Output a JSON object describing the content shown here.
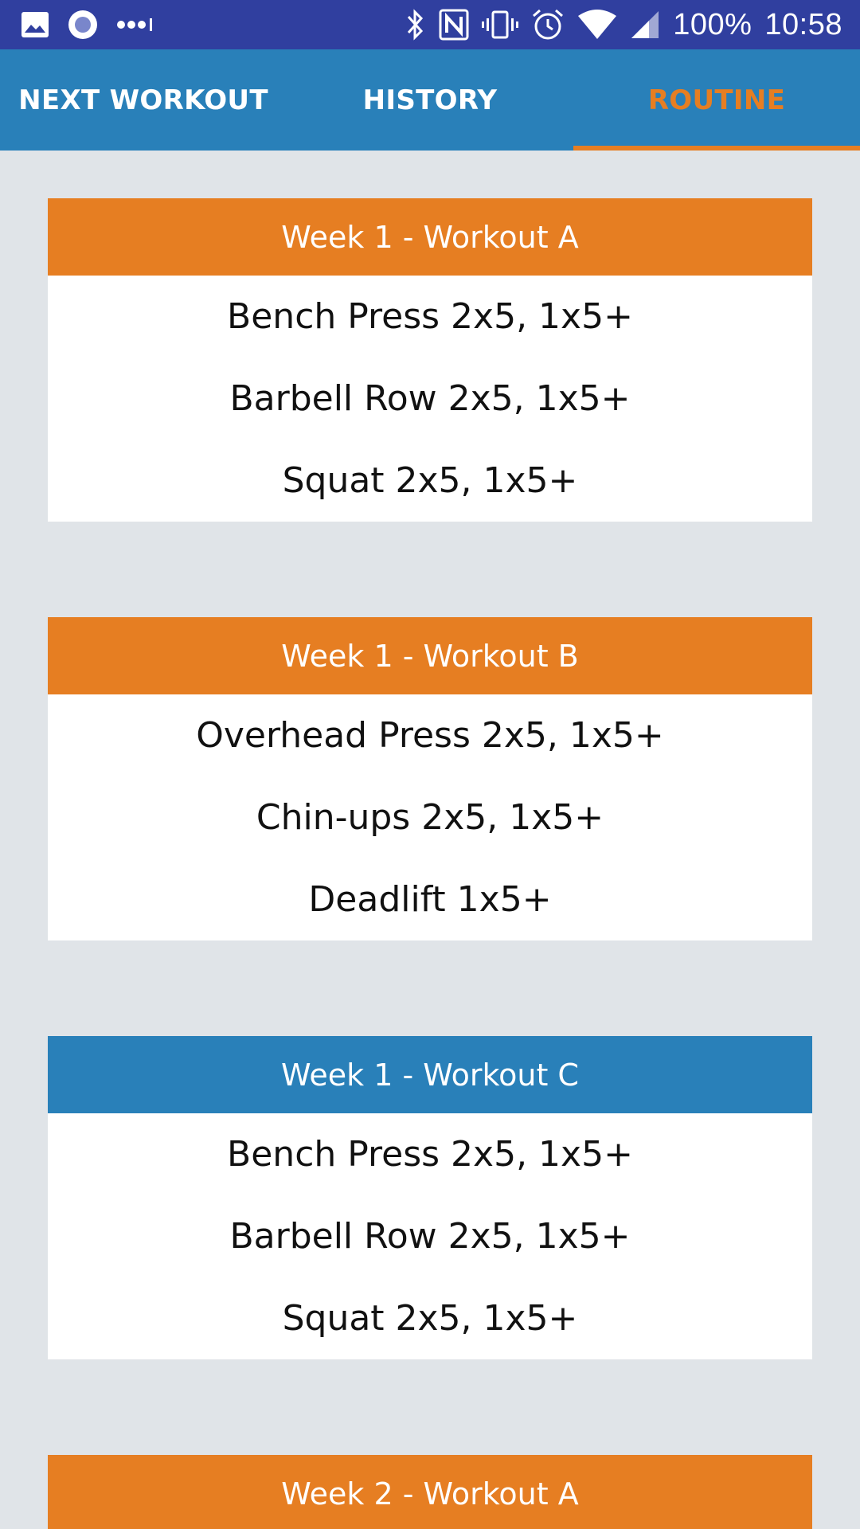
{
  "status_bar": {
    "battery": "100%",
    "time": "10:58",
    "left_icons": [
      "image-icon",
      "record-icon",
      "more-dots-icon"
    ],
    "right_icons": [
      "bluetooth-icon",
      "nfc-icon",
      "vibrate-icon",
      "alarm-icon",
      "wifi-icon",
      "signal-icon"
    ]
  },
  "tabs": [
    {
      "label": "NEXT WORKOUT",
      "active": false
    },
    {
      "label": "HISTORY",
      "active": false
    },
    {
      "label": "ROUTINE",
      "active": true
    }
  ],
  "colors": {
    "status_bar": "#303f9f",
    "primary": "#2980b9",
    "accent": "#e67e22",
    "background": "#e0e4e8"
  },
  "workouts": [
    {
      "title": "Week 1 - Workout A",
      "header_color": "orange",
      "exercises": [
        "Bench Press 2x5, 1x5+",
        "Barbell Row 2x5, 1x5+",
        "Squat 2x5, 1x5+"
      ]
    },
    {
      "title": "Week 1 - Workout B",
      "header_color": "orange",
      "exercises": [
        "Overhead Press 2x5, 1x5+",
        "Chin-ups 2x5, 1x5+",
        "Deadlift 1x5+"
      ]
    },
    {
      "title": "Week 1 - Workout C",
      "header_color": "blue",
      "exercises": [
        "Bench Press 2x5, 1x5+",
        "Barbell Row 2x5, 1x5+",
        "Squat 2x5, 1x5+"
      ]
    },
    {
      "title": "Week 2 - Workout A",
      "header_color": "orange",
      "exercises": []
    }
  ]
}
